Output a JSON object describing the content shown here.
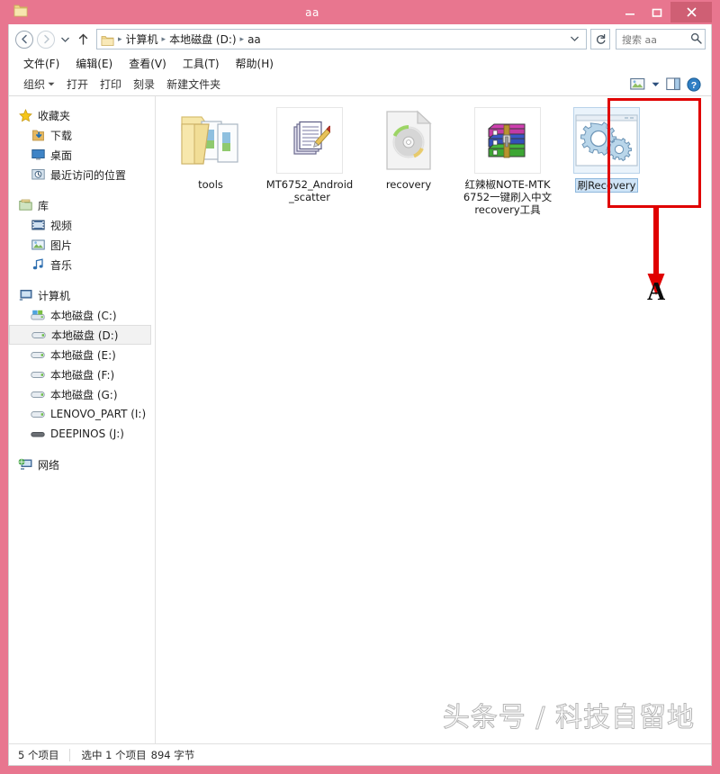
{
  "window": {
    "title": "aa",
    "icon": "folder-icon",
    "controls": {
      "minimize": "–",
      "maximize": "❐",
      "close": "✕"
    },
    "accent_color": "#e8768f",
    "close_color": "#cf5f74"
  },
  "addressbar": {
    "back": "‹",
    "forward": "›",
    "history_caret": "▼",
    "up": "↑",
    "crumbs": [
      "计算机",
      "本地磁盘 (D:)",
      "aa"
    ],
    "crumb_separator": "▸",
    "dropdown_caret": "⌄",
    "refresh": "↻",
    "search_placeholder": "搜索 aa",
    "search_icon": "🔍"
  },
  "menubar": {
    "items": [
      {
        "label": "文件(F)"
      },
      {
        "label": "编辑(E)"
      },
      {
        "label": "查看(V)"
      },
      {
        "label": "工具(T)"
      },
      {
        "label": "帮助(H)"
      }
    ]
  },
  "toolbar": {
    "items": [
      {
        "label": "组织",
        "caret": "▾"
      },
      {
        "label": "打开",
        "caret": ""
      },
      {
        "label": "打印",
        "caret": ""
      },
      {
        "label": "刻录",
        "caret": ""
      },
      {
        "label": "新建文件夹",
        "caret": ""
      }
    ],
    "right": {
      "view_caret": "▾",
      "help_label": "?"
    }
  },
  "sidebar": {
    "sections": [
      {
        "header": {
          "label": "收藏夹",
          "icon": "star-icon"
        },
        "items": [
          {
            "label": "下载",
            "icon": "download-icon"
          },
          {
            "label": "桌面",
            "icon": "desktop-icon"
          },
          {
            "label": "最近访问的位置",
            "icon": "recent-places-icon"
          }
        ]
      },
      {
        "header": {
          "label": "库",
          "icon": "library-icon"
        },
        "items": [
          {
            "label": "视频",
            "icon": "video-icon"
          },
          {
            "label": "图片",
            "icon": "pictures-icon"
          },
          {
            "label": "音乐",
            "icon": "music-icon"
          }
        ]
      },
      {
        "header": {
          "label": "计算机",
          "icon": "computer-icon"
        },
        "items": [
          {
            "label": "本地磁盘 (C:)",
            "icon": "system-drive-icon",
            "selected": false
          },
          {
            "label": "本地磁盘 (D:)",
            "icon": "drive-icon",
            "selected": true
          },
          {
            "label": "本地磁盘 (E:)",
            "icon": "drive-icon",
            "selected": false
          },
          {
            "label": "本地磁盘 (F:)",
            "icon": "drive-icon",
            "selected": false
          },
          {
            "label": "本地磁盘 (G:)",
            "icon": "drive-icon",
            "selected": false
          },
          {
            "label": "LENOVO_PART (I:)",
            "icon": "drive-icon",
            "selected": false
          },
          {
            "label": "DEEPINOS (J:)",
            "icon": "disk-icon",
            "selected": false
          }
        ]
      },
      {
        "header": {
          "label": "网络",
          "icon": "network-icon"
        },
        "items": []
      }
    ]
  },
  "files": [
    {
      "name": "tools",
      "icon": "folder-open-icon",
      "framed": false,
      "selected": false
    },
    {
      "name": "MT6752_Android_scatter",
      "icon": "text-document-icon",
      "framed": true,
      "selected": false
    },
    {
      "name": "recovery",
      "icon": "disc-image-icon",
      "framed": false,
      "selected": false
    },
    {
      "name": "红辣椒NOTE-MTK6752一键刷入中文recovery工具",
      "icon": "winrar-archive-icon",
      "framed": true,
      "selected": false
    },
    {
      "name": "刷Recovery",
      "icon": "gears-application-icon",
      "framed": true,
      "selected": true
    }
  ],
  "annotation": {
    "letter": "A",
    "color": "#e00000",
    "target": "刷Recovery"
  },
  "statusbar": {
    "item_count": "5 个项目",
    "selection": "选中 1 个项目",
    "size": "894 字节"
  },
  "watermark": {
    "text": "头条号 / 科技自留地"
  }
}
